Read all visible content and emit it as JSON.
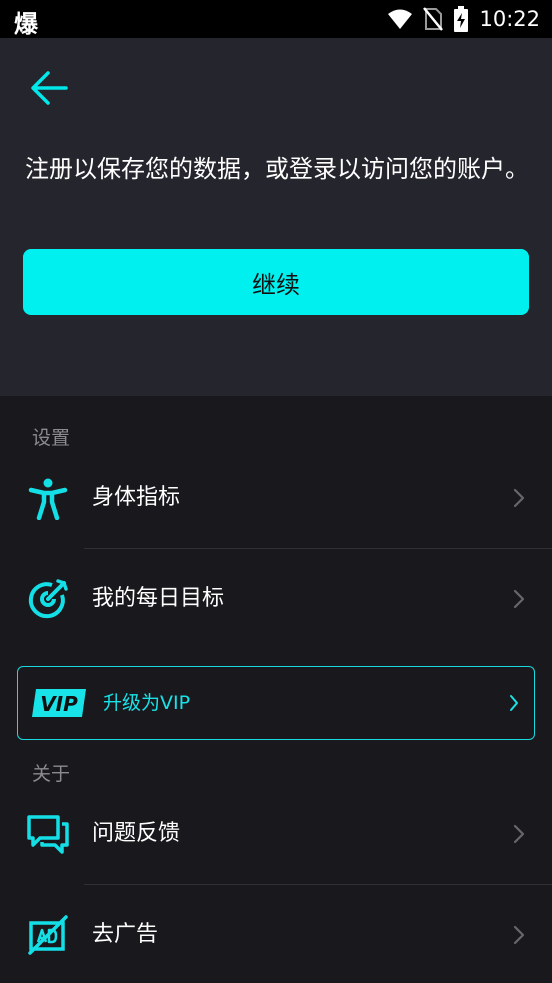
{
  "status_bar": {
    "left_glyph": "爆",
    "time": "10:22",
    "icons": [
      "wifi-icon",
      "no-sim-icon",
      "battery-charging-icon"
    ]
  },
  "header": {
    "back_icon": "arrow-left-icon",
    "intro": "注册以保存您的数据，或登录以访问您的账户。",
    "continue_label": "继续"
  },
  "settings": {
    "section_title": "设置",
    "items": [
      {
        "label": "身体指标",
        "icon": "body-figure-icon"
      },
      {
        "label": "我的每日目标",
        "icon": "target-icon"
      }
    ]
  },
  "vip": {
    "badge": "VIP",
    "label": "升级为VIP"
  },
  "about": {
    "section_title": "关于",
    "items": [
      {
        "label": "问题反馈",
        "icon": "feedback-chat-icon"
      },
      {
        "label": "去广告",
        "icon": "no-ads-icon"
      }
    ]
  },
  "colors": {
    "accent": "#00f0f0",
    "header_bg": "#24252d",
    "page_bg": "#19191d"
  }
}
